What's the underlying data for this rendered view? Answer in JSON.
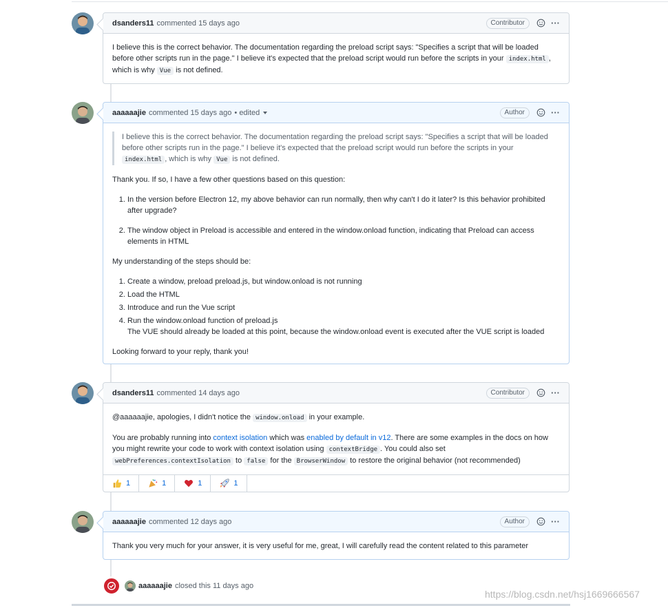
{
  "comments": [
    {
      "author": "dsanders11",
      "meta": "commented 15 days ago",
      "badge": "Contributor",
      "p1_text1": "I believe this is the correct behavior. The documentation regarding the preload script says: \"Specifies a script that will be loaded before other scripts run in the page.\" I believe it's expected that the preload script would run before the scripts in your ",
      "p1_code1": "index.html",
      "p1_text2": ", which is why ",
      "p1_code2": "Vue",
      "p1_text3": " is not defined."
    },
    {
      "author": "aaaaaajie",
      "meta": "commented 15 days ago",
      "edited": "• edited",
      "badge": "Author",
      "quote_text1": "I believe this is the correct behavior. The documentation regarding the preload script says: \"Specifies a script that will be loaded before other scripts run in the page.\" I believe it's expected that the preload script would run before the scripts in your ",
      "quote_code1": "index.html",
      "quote_text2": ", which is why ",
      "quote_code2": "Vue",
      "quote_text3": " is not defined.",
      "intro": "Thank you. If so, I have a few other questions based on this question:",
      "questions": [
        "In the version before Electron 12, my above behavior can run normally, then why can't I do it later? Is this behavior prohibited after upgrade?",
        "The window object in Preload is accessible and entered in the window.onload function, indicating that Preload can access elements in HTML"
      ],
      "steps_intro": "My understanding of the steps should be:",
      "steps": [
        "Create a window, preload preload.js, but window.onload is not running",
        "Load the HTML",
        "Introduce and run the Vue script",
        "Run the window.onload function of preload.js"
      ],
      "step4_note": "The VUE should already be loaded at this point, because the window.onload event is executed after the VUE script is loaded",
      "closing": "Looking forward to your reply, thank you!"
    },
    {
      "author": "dsanders11",
      "meta": "commented 14 days ago",
      "badge": "Contributor",
      "p1_text1": "@aaaaaajie, apologies, I didn't notice the ",
      "p1_code": "window.onload",
      "p1_text2": " in your example.",
      "p2_text1": "You are probably running into ",
      "p2_link1": "context isolation",
      "p2_text2": " which was ",
      "p2_link2": "enabled by default in v12",
      "p2_text3": ". There are some examples in the docs on how you might rewrite your code to work with context isolation using ",
      "p2_code1": "contextBridge",
      "p2_text4": ". You could also set ",
      "p2_code2": "webPreferences.contextIsolation",
      "p2_text5": " to ",
      "p2_code3": "false",
      "p2_text6": " for the ",
      "p2_code4": "BrowserWindow",
      "p2_text7": " to restore the original behavior (not recommended)",
      "reactions": [
        {
          "icon": "thumbs-up",
          "count": "1"
        },
        {
          "icon": "tada",
          "count": "1"
        },
        {
          "icon": "heart",
          "count": "1"
        },
        {
          "icon": "rocket",
          "count": "1"
        }
      ]
    },
    {
      "author": "aaaaaajie",
      "meta": "commented 12 days ago",
      "badge": "Author",
      "body": "Thank you very much for your answer, it is very useful for me, great, I will carefully read the content related to this parameter"
    }
  ],
  "event": {
    "author": "aaaaaajie",
    "text": "closed this 11 days ago"
  },
  "watermark": "https://blog.csdn.net/hsj1669666567",
  "colors": {
    "closed_red": "#cf222e",
    "link_blue": "#0969da",
    "own_border": "#b6d1ef"
  }
}
